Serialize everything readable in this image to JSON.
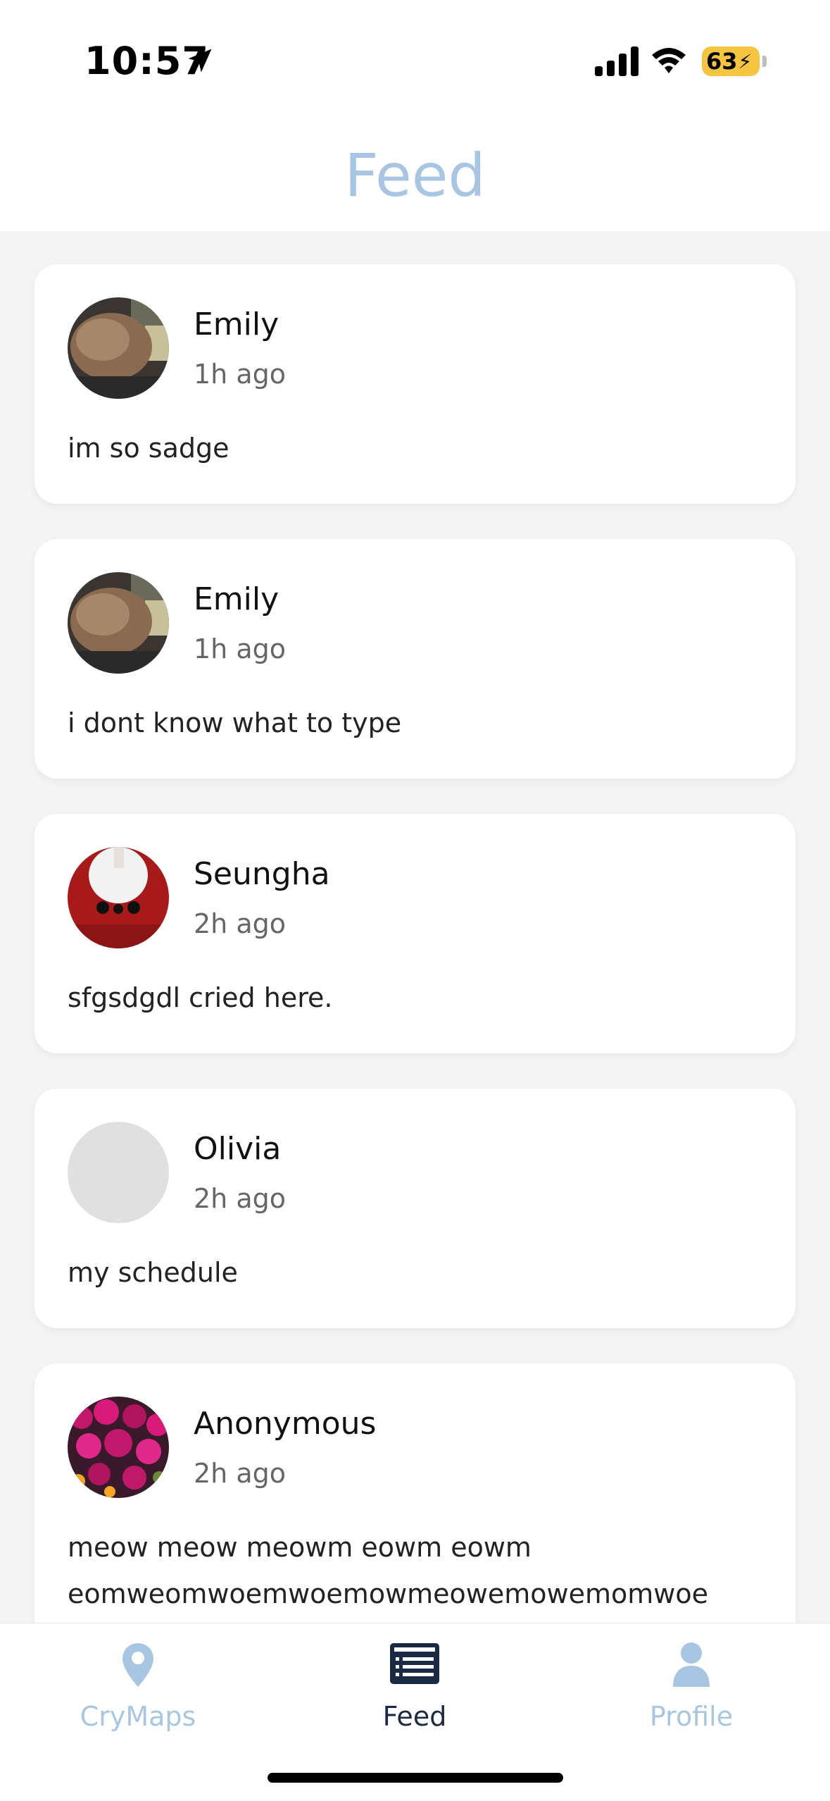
{
  "status_bar": {
    "time": "10:57",
    "battery_level": "63",
    "battery_color": "#f5c542",
    "icons": [
      "location-arrow-icon",
      "cellular-signal-icon",
      "wifi-icon",
      "battery-charging-icon"
    ]
  },
  "header": {
    "title": "Feed",
    "title_color": "#a8c6e2"
  },
  "posts": [
    {
      "name": "Emily",
      "time": "1h ago",
      "text": "im so sadge",
      "avatar": "photo"
    },
    {
      "name": "Emily",
      "time": "1h ago",
      "text": "i dont know what to type",
      "avatar": "photo"
    },
    {
      "name": "Seungha",
      "time": "2h ago",
      "text": "sfgsdgdl cried here.",
      "avatar": "photo"
    },
    {
      "name": "Olivia",
      "time": "2h ago",
      "text": "my schedule",
      "avatar": "placeholder"
    },
    {
      "name": "Anonymous",
      "time": "2h ago",
      "text": "meow meow meowm eowm eowm eomweomwoemwoemowmeowemowemomwoe",
      "avatar": "photo"
    }
  ],
  "tab_bar": {
    "tabs": [
      {
        "label": "CryMaps",
        "icon": "map-pin-icon",
        "active": false
      },
      {
        "label": "Feed",
        "icon": "feed-list-icon",
        "active": true
      },
      {
        "label": "Profile",
        "icon": "person-icon",
        "active": false
      }
    ],
    "active_color": "#1b2a44",
    "inactive_color": "#a8c6e2"
  }
}
